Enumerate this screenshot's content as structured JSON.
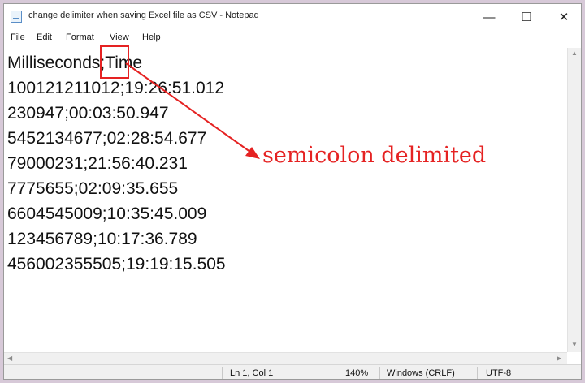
{
  "window": {
    "title": "change delimiter when saving Excel file as CSV - Notepad",
    "minimize": "—",
    "maximize": "☐",
    "close": "✕"
  },
  "menu": {
    "items": [
      "File",
      "Edit",
      "Format",
      "View",
      "Help"
    ]
  },
  "editor": {
    "lines": [
      "Milliseconds;Time",
      "100121211012;19:26:51.012",
      "230947;00:03:50.947",
      "5452134677;02:28:54.677",
      "79000231;21:56:40.231",
      "7775655;02:09:35.655",
      "6604545009;10:35:45.009",
      "123456789;10:17:36.789",
      "456002355505;19:19:15.505"
    ]
  },
  "status": {
    "position": "Ln 1, Col 1",
    "zoom": "140%",
    "line_ending": "Windows (CRLF)",
    "encoding": "UTF-8"
  },
  "annotation": {
    "label": "semicolon delimited",
    "color": "#e52222"
  }
}
